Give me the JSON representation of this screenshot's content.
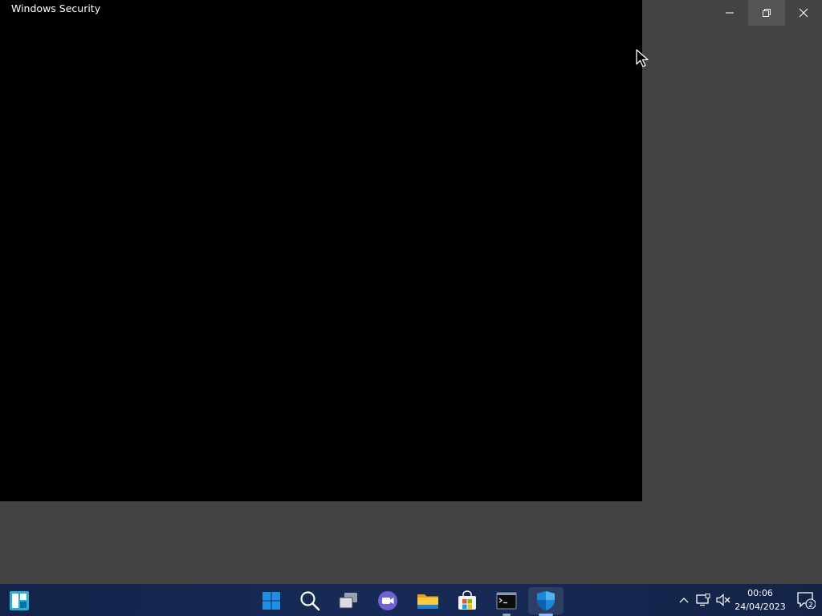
{
  "window": {
    "title": "Windows Security",
    "controls": {
      "minimize": "minimize-icon",
      "restore": "restore-icon",
      "close": "close-icon"
    }
  },
  "taskbar": {
    "widgets_icon": "widgets-icon",
    "apps": [
      {
        "name": "Start",
        "icon": "windows-start-icon"
      },
      {
        "name": "Search",
        "icon": "search-icon"
      },
      {
        "name": "Task View",
        "icon": "task-view-icon"
      },
      {
        "name": "Chat",
        "icon": "teams-chat-icon"
      },
      {
        "name": "File Explorer",
        "icon": "folder-icon"
      },
      {
        "name": "Microsoft Store",
        "icon": "store-icon"
      },
      {
        "name": "Command Prompt",
        "icon": "terminal-icon",
        "running": true
      },
      {
        "name": "Windows Security",
        "icon": "shield-icon",
        "running": true,
        "active": true
      }
    ],
    "tray": {
      "icons": [
        "chevron-up-icon",
        "network-icon",
        "volume-muted-icon"
      ],
      "time": "00:06",
      "date": "24/04/2023",
      "notification_count": "2"
    }
  },
  "colors": {
    "taskbar_bg": "#172a55",
    "window_bg": "#434343",
    "accent": "#1a8ad8"
  }
}
